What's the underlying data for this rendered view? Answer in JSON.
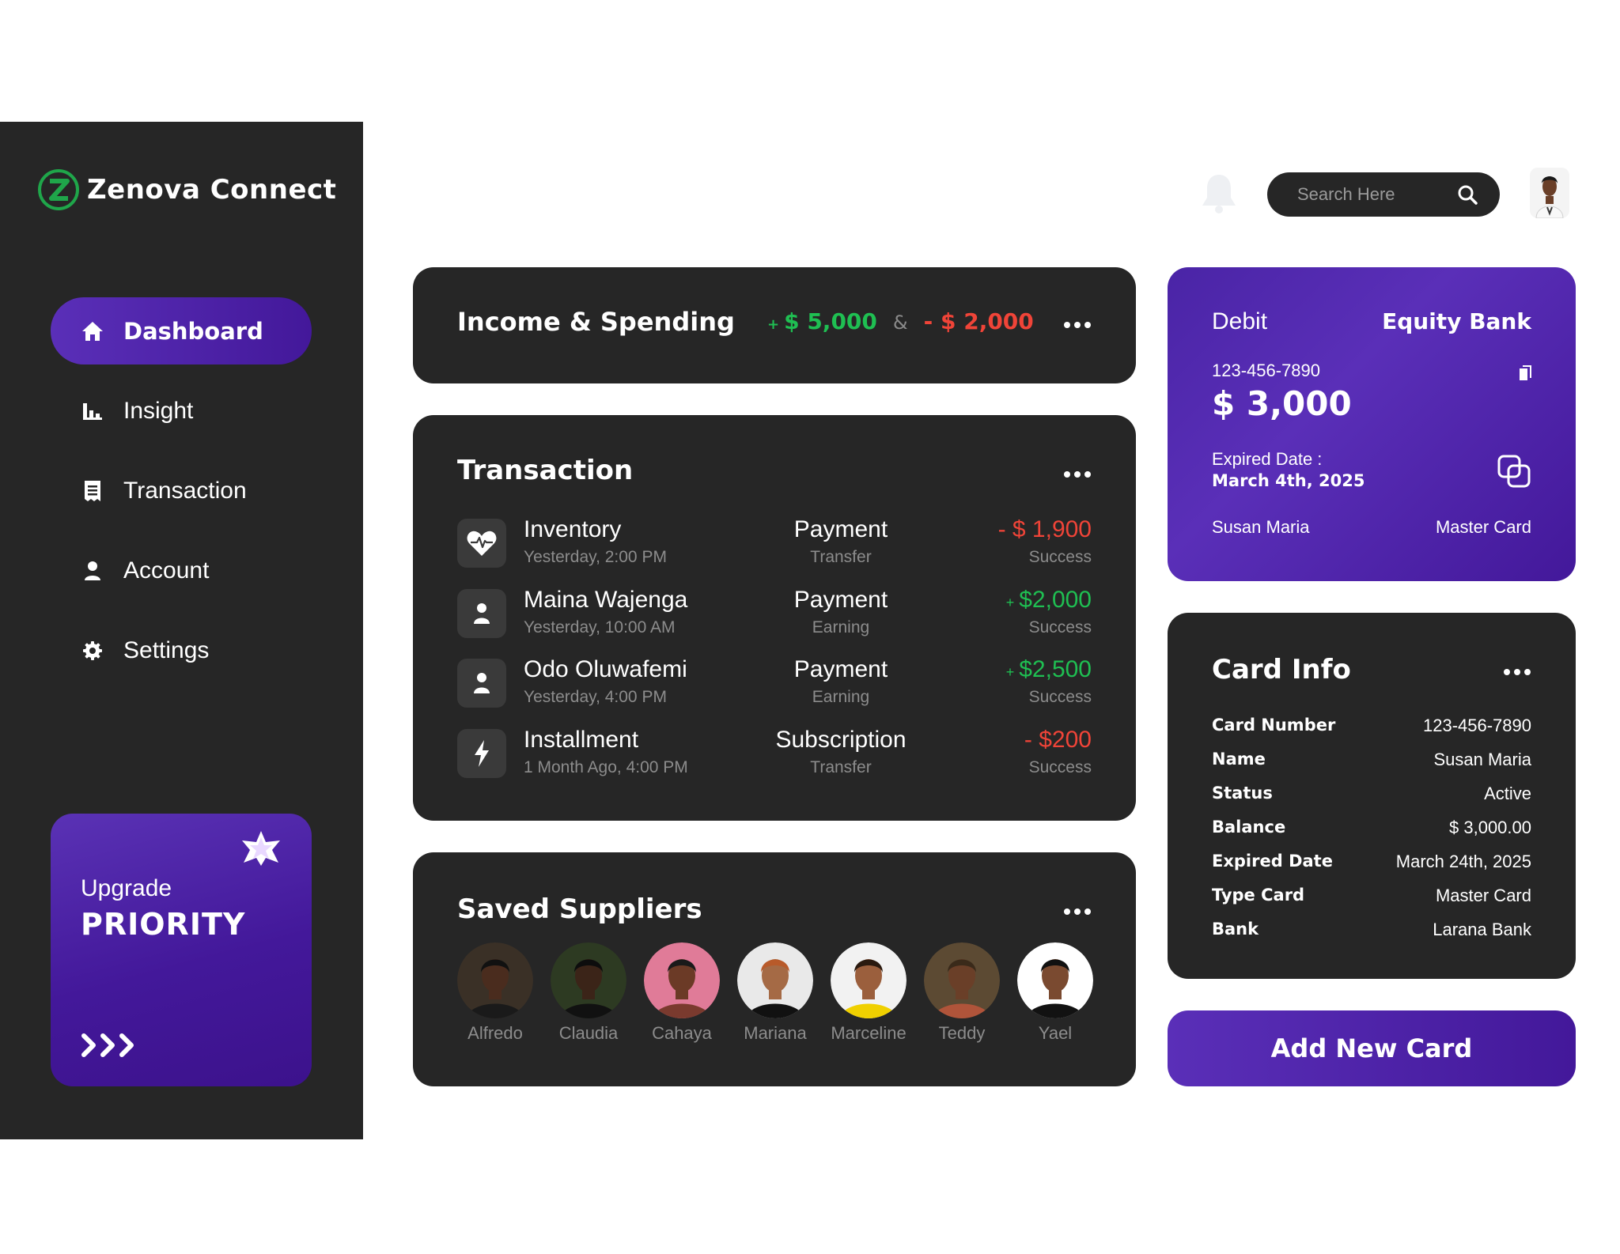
{
  "brand": {
    "name": "Zenova Connect"
  },
  "nav": [
    {
      "label": "Dashboard",
      "icon": "home-icon",
      "active": true
    },
    {
      "label": "Insight",
      "icon": "bar-chart-icon"
    },
    {
      "label": "Transaction",
      "icon": "receipt-icon"
    },
    {
      "label": "Account",
      "icon": "user-icon"
    },
    {
      "label": "Settings",
      "icon": "gear-icon"
    }
  ],
  "upgrade": {
    "label": "Upgrade",
    "title": "PRIORITY"
  },
  "search": {
    "placeholder": "Search Here"
  },
  "income": {
    "title": "Income & Spending",
    "income_sign": "+",
    "income_value": "$ 5,000",
    "separator": "&",
    "spending_value": "- $ 2,000"
  },
  "transaction": {
    "title": "Transaction",
    "rows": [
      {
        "name": "Inventory",
        "time": "Yesterday, 2:00 PM",
        "type": "Payment",
        "subtype": "Transfer",
        "amount": "- $ 1,900",
        "direction": "out",
        "status": "Success",
        "icon": "heart-pulse-icon"
      },
      {
        "name": "Maina Wajenga",
        "time": "Yesterday, 10:00 AM",
        "type": "Payment",
        "subtype": "Earning",
        "amount": "$2,000",
        "direction": "in",
        "status": "Success",
        "icon": "person-icon"
      },
      {
        "name": "Odo Oluwafemi",
        "time": "Yesterday, 4:00 PM",
        "type": "Payment",
        "subtype": "Earning",
        "amount": "$2,500",
        "direction": "in",
        "status": "Success",
        "icon": "person-icon"
      },
      {
        "name": "Installment",
        "time": "1 Month Ago, 4:00 PM",
        "type": "Subscription",
        "subtype": "Transfer",
        "amount": "- $200",
        "direction": "out",
        "status": "Success",
        "icon": "lightning-icon"
      }
    ]
  },
  "suppliers": {
    "title": "Saved Suppliers",
    "items": [
      {
        "name": "Alfredo",
        "bg": "#3a3026",
        "skin": "#4a2c1e",
        "hair": "#111111",
        "shirt": "#1a1a1a"
      },
      {
        "name": "Claudia",
        "bg": "#2d3a22",
        "skin": "#3b2418",
        "hair": "#0d0d0d",
        "shirt": "#111111"
      },
      {
        "name": "Cahaya",
        "bg": "#e07b98",
        "skin": "#6b3a26",
        "hair": "#1a1a1a",
        "shirt": "#7a3a2e"
      },
      {
        "name": "Mariana",
        "bg": "#e9e9e9",
        "skin": "#a56a45",
        "hair": "#b85a2a",
        "shirt": "#111111"
      },
      {
        "name": "Marceline",
        "bg": "#f2f2f2",
        "skin": "#9b5f3d",
        "hair": "#2a1a10",
        "shirt": "#f0d000"
      },
      {
        "name": "Teddy",
        "bg": "#5c4a33",
        "skin": "#6a3f28",
        "hair": "#3a2a1a",
        "shirt": "#b0543a"
      },
      {
        "name": "Yael",
        "bg": "#ffffff",
        "skin": "#7a4a30",
        "hair": "#111111",
        "shirt": "#121212"
      }
    ]
  },
  "debit_card": {
    "type": "Debit",
    "bank": "Equity Bank",
    "number": "123-456-7890",
    "balance": "$ 3,000",
    "expiry_label": "Expired Date :",
    "expiry": "March 4th, 2025",
    "holder": "Susan Maria",
    "network": "Master Card"
  },
  "card_info": {
    "title": "Card Info",
    "rows": [
      {
        "key": "Card Number",
        "value": "123-456-7890"
      },
      {
        "key": "Name",
        "value": "Susan Maria"
      },
      {
        "key": "Status",
        "value": "Active"
      },
      {
        "key": "Balance",
        "value": "$ 3,000.00"
      },
      {
        "key": "Expired Date",
        "value": "March 24th, 2025"
      },
      {
        "key": "Type Card",
        "value": "Master Card"
      },
      {
        "key": "Bank",
        "value": "Larana Bank"
      }
    ]
  },
  "add_card": {
    "label": "Add New Card"
  },
  "colors": {
    "accent": "#4a22a8",
    "panel": "#262626",
    "positive": "#1fbf52",
    "negative": "#f04438",
    "muted": "#8c8c8c"
  }
}
